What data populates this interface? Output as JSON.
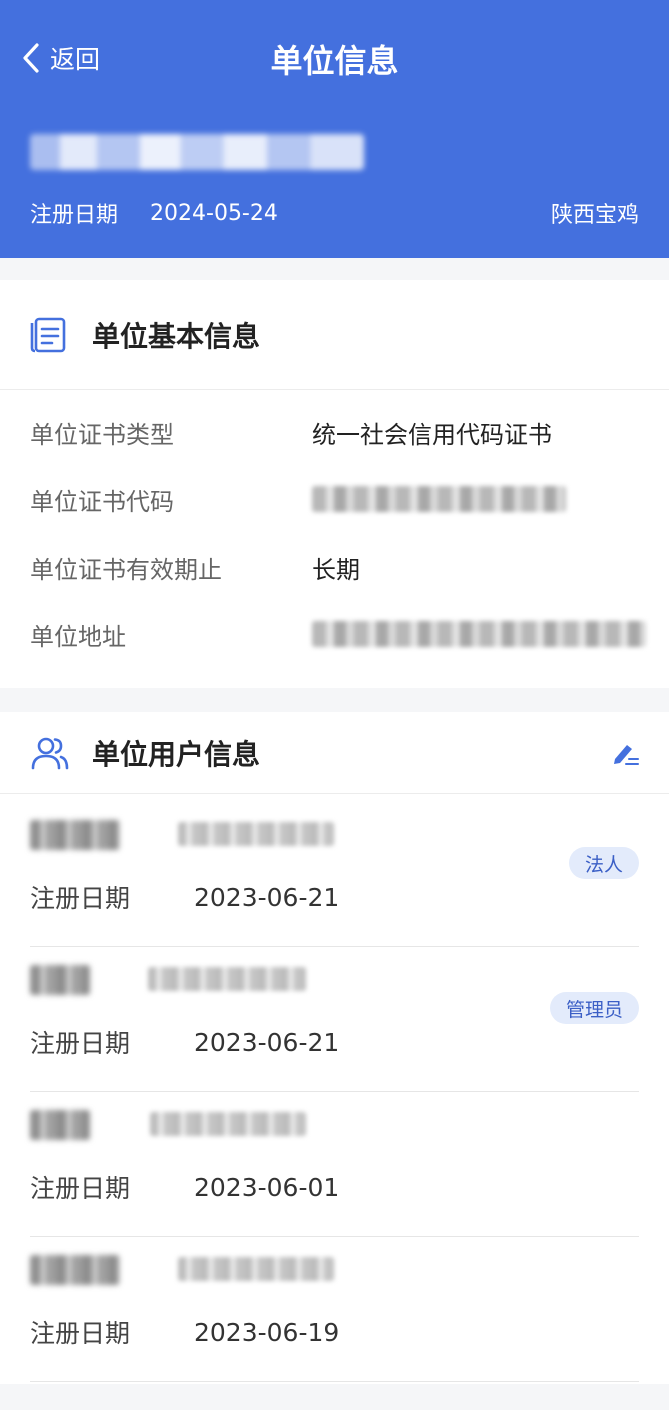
{
  "nav": {
    "back_label": "返回",
    "title": "单位信息"
  },
  "summary": {
    "reg_label": "注册日期",
    "reg_date": "2024-05-24",
    "region": "陕西宝鸡"
  },
  "basic_info": {
    "heading": "单位基本信息",
    "rows": [
      {
        "label": "单位证书类型",
        "value": "统一社会信用代码证书"
      },
      {
        "label": "单位证书代码",
        "value": ""
      },
      {
        "label": "单位证书有效期止",
        "value": "长期"
      },
      {
        "label": "单位地址",
        "value": ""
      }
    ]
  },
  "users_info": {
    "heading": "单位用户信息",
    "date_label": "注册日期",
    "users": [
      {
        "date": "2023-06-21",
        "role": "法人"
      },
      {
        "date": "2023-06-21",
        "role": "管理员"
      },
      {
        "date": "2023-06-01",
        "role": ""
      },
      {
        "date": "2023-06-19",
        "role": ""
      }
    ]
  },
  "colors": {
    "header_bg": "#4470de",
    "badge_bg": "#e3ebfb",
    "badge_text": "#3b5fc6",
    "icon_blue": "#4470de"
  }
}
